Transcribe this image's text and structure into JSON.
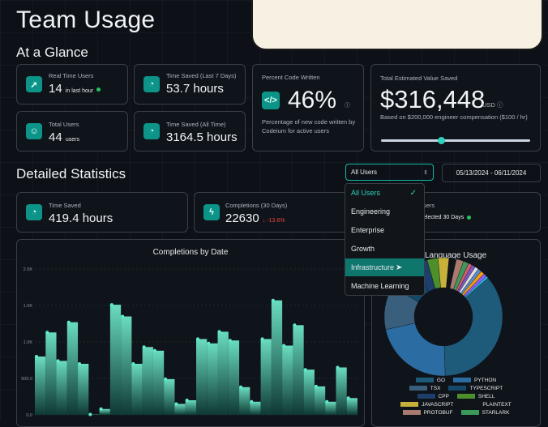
{
  "page_title": "Team Usage",
  "at_a_glance": {
    "heading": "At a Glance",
    "real_time_users": {
      "label": "Real Time Users",
      "value": "14",
      "suffix": "in last hour"
    },
    "time_saved_7d": {
      "label": "Time Saved (Last 7 Days)",
      "value": "53.7 hours"
    },
    "total_users": {
      "label": "Total Users",
      "value": "44",
      "suffix": "users"
    },
    "time_saved_all": {
      "label": "Time Saved (All Time)",
      "value": "3164.5 hours"
    },
    "percent_code": {
      "label": "Percent Code Written",
      "value": "46%",
      "desc": "Percentage of new code written by Codeium for active users"
    },
    "value_saved": {
      "label": "Total Estimated Value Saved",
      "value": "$316,448",
      "unit": "USD",
      "basis": "Based on $200,000 engineer compensation ($100 / hr)",
      "slider_level": 0.4
    }
  },
  "detailed": {
    "heading": "Detailed Statistics",
    "filter": {
      "selected": "All Users",
      "chevron": "⌃⌄"
    },
    "date_range": "05/13/2024 - 06/11/2024",
    "dropdown_options": [
      "All Users",
      "Engineering",
      "Enterprise",
      "Growth",
      "Infrastructure",
      "Machine Learning"
    ],
    "time_saved": {
      "label": "Time Saved",
      "value": "419.4 hours"
    },
    "completions": {
      "label": "Completions (30 Days)",
      "value": "22630",
      "change": "↓ -13.6%"
    },
    "users_card": {
      "label": "sers",
      "suffix": "elected 30 Days"
    }
  },
  "colors": {
    "accent": "#0d9488",
    "negative": "#ef4444",
    "online": "#22c55e"
  },
  "chart_data": [
    {
      "type": "bar",
      "title": "Completions by Date",
      "ylim": [
        0,
        2000
      ],
      "yticks": [
        "2.0K",
        "1.5K",
        "1.0K",
        "500.0",
        "0.0"
      ],
      "values": [
        800,
        1130,
        740,
        1270,
        700,
        5,
        80,
        1510,
        1350,
        700,
        930,
        880,
        490,
        150,
        200,
        1040,
        980,
        1140,
        1020,
        380,
        180,
        1040,
        1570,
        950,
        1230,
        620,
        390,
        180,
        650,
        230
      ]
    },
    {
      "type": "pie",
      "title": "Language Usage",
      "legend": [
        "GO",
        "PYTHON",
        "TSX",
        "TYPESCRIPT",
        "CPP",
        "SHELL",
        "JAVASCRIPT",
        "PLAINTEXT",
        "PROTOBUF",
        "STARLARK"
      ],
      "values": [
        36,
        22,
        12,
        8,
        4,
        3,
        3,
        2,
        2,
        1.5,
        1,
        1,
        1,
        1,
        1,
        1,
        0.5
      ]
    }
  ]
}
